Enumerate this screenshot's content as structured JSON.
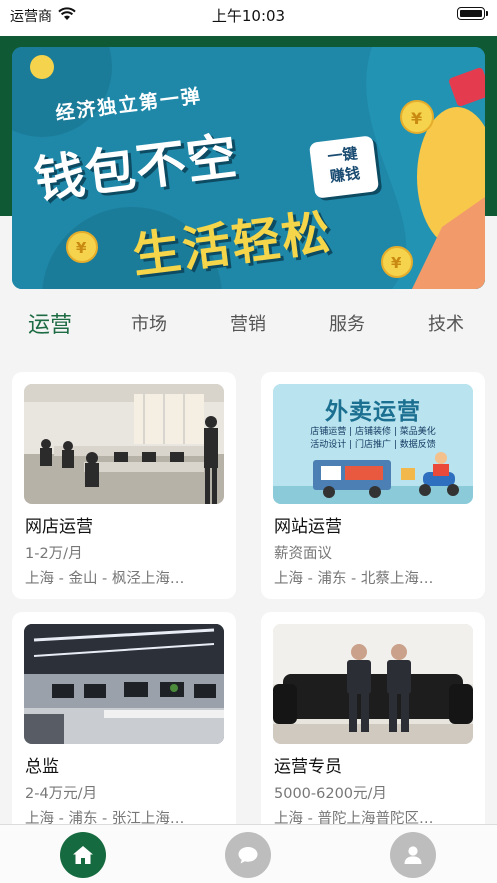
{
  "status_bar": {
    "carrier": "运营商",
    "time": "上午10:03"
  },
  "banner": {
    "line1": "经济独立第一弹",
    "line2": "钱包不空",
    "line3": "生活轻松",
    "badge_line1": "一键",
    "badge_line2": "赚钱"
  },
  "tabs": [
    {
      "label": "运营",
      "active": true
    },
    {
      "label": "市场",
      "active": false
    },
    {
      "label": "营销",
      "active": false
    },
    {
      "label": "服务",
      "active": false
    },
    {
      "label": "技术",
      "active": false
    }
  ],
  "jobs": [
    {
      "title": "网店运营",
      "salary": "1-2万/月",
      "location": "上海 - 金山 - 枫泾上海…",
      "image": "office-meeting-photo"
    },
    {
      "title": "网站运营",
      "salary": "薪资面议",
      "location": "上海 - 浦东 - 北蔡上海…",
      "image": "takeout-operation-illustration",
      "image_text": {
        "heading": "外卖运营",
        "row1": "店铺运营 | 店铺装修 | 菜品美化",
        "row2": "活动设计 | 门店推广 | 数据反馈"
      }
    },
    {
      "title": "总监",
      "salary": "2-4万元/月",
      "location": "上海 - 浦东 - 张江上海…",
      "image": "open-office-photo"
    },
    {
      "title": "运营专员",
      "salary": "5000-6200元/月",
      "location": "上海 - 普陀上海普陀区…",
      "image": "two-men-on-sofa-photo"
    }
  ],
  "tab_bar": [
    "home-icon",
    "chat-icon",
    "profile-icon"
  ],
  "colors": {
    "brand_green": "#166a3f",
    "header_green": "#0f5a35",
    "banner_blue": "#1f88a8",
    "accent_yellow": "#f5d54a"
  }
}
